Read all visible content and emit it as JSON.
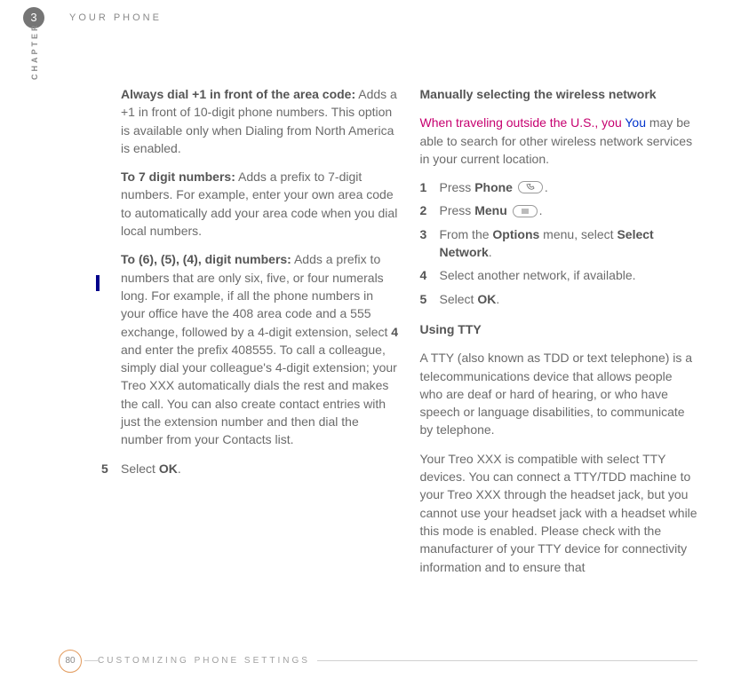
{
  "header": {
    "chapter_number": "3",
    "title": "YOUR PHONE",
    "vertical_label": "CHAPTER"
  },
  "left": {
    "p1_bold": "Always dial +1 in front of the area code:",
    "p1_rest": " Adds a +1 in front of 10-digit phone numbers. This option is available only when Dialing from North America is enabled.",
    "p2_bold": "To 7 digit numbers:",
    "p2_rest": " Adds a prefix to 7-digit numbers. For example, enter your own area code to automatically add your area code when you dial local numbers.",
    "p3_bold": "To (6), (5), (4), digit numbers:",
    "p3_rest_a": " Adds a prefix to numbers that are only six, five, or four numerals long. For example, if all the phone numbers in your office have the 408 area code and a 555 exchange, followed by a 4-digit extension, select ",
    "p3_bold_4": "4",
    "p3_rest_b": " and enter the prefix 408555. To call a colleague, simply dial your colleague's 4-digit extension; your Treo XXX automatically dials the rest and makes the call. You can also create contact entries with just the extension number and then dial the number from your Contacts list.",
    "step5_num": "5",
    "step5_a": "Select ",
    "step5_b": "OK",
    "step5_c": "."
  },
  "right": {
    "h1": "Manually selecting the wireless network",
    "p1_red": "When traveling outside the U.S., you ",
    "p1_blue": "You",
    "p1_rest": " may be able to search for other wireless network services in your current location.",
    "steps": [
      {
        "num": "1",
        "a": "Press ",
        "b": "Phone",
        "c": " ",
        "icon": "phone",
        "d": "."
      },
      {
        "num": "2",
        "a": "Press ",
        "b": "Menu",
        "c": " ",
        "icon": "menu",
        "d": "."
      },
      {
        "num": "3",
        "a": "From the ",
        "b": "Options",
        "c": " menu, select ",
        "b2": "Select Network",
        "d": "."
      },
      {
        "num": "4",
        "a": "Select another network, if available."
      },
      {
        "num": "5",
        "a": "Select ",
        "b": "OK",
        "d": "."
      }
    ],
    "h2": "Using TTY",
    "p2": "A TTY (also known as TDD or text telephone) is a telecommunications device that allows people who are deaf or hard of hearing, or who have speech or language disabilities, to communicate by telephone.",
    "p3": "Your Treo XXX is compatible with select TTY devices. You can connect a TTY/TDD machine to your Treo XXX through the headset jack, but you cannot use your headset jack with a headset while this mode is enabled. Please check with the manufacturer of your TTY device for connectivity information and to ensure that"
  },
  "footer": {
    "page": "80",
    "title": "CUSTOMIZING PHONE SETTINGS"
  }
}
